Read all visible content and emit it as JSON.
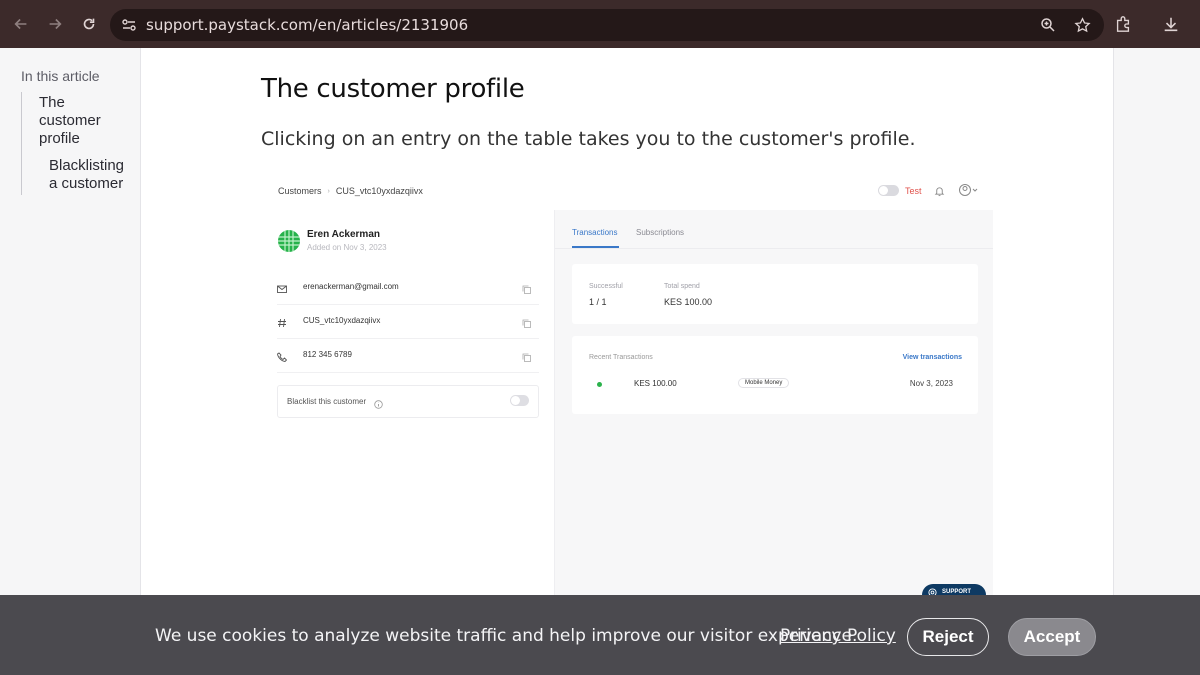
{
  "browser": {
    "url": "support.paystack.com/en/articles/2131906"
  },
  "toc": {
    "title": "In this article",
    "items": [
      {
        "label": "The customer profile"
      },
      {
        "label": "Blacklisting a customer"
      }
    ]
  },
  "article": {
    "heading": "The customer profile",
    "paragraph": "Clicking on an entry on the table takes you to the customer's profile."
  },
  "screenshot": {
    "breadcrumb": [
      "Customers",
      "CUS_vtc10yxdazqiivx"
    ],
    "test_label": "Test",
    "customer": {
      "name": "Eren Ackerman",
      "added": "Added on Nov 3, 2023",
      "email": "erenackerman@gmail.com",
      "code": "CUS_vtc10yxdazqiivx",
      "phone": "812 345 6789"
    },
    "blacklist_label": "Blacklist this customer",
    "tabs": [
      "Transactions",
      "Subscriptions"
    ],
    "stats": {
      "successful_label": "Successful",
      "successful_value": "1 / 1",
      "total_label": "Total spend",
      "total_value": "KES 100.00"
    },
    "recent": {
      "title": "Recent Transactions",
      "view_all": "View transactions",
      "row": {
        "amount": "KES 100.00",
        "channel": "Mobile Money",
        "date": "Nov 3, 2023"
      }
    },
    "support_label": "SUPPORT"
  },
  "cookie": {
    "text": "We use cookies to analyze website traffic and help improve our visitor experience.",
    "link": "Privacy Policy",
    "reject": "Reject",
    "accept": "Accept"
  },
  "colors": {
    "browser_bar": "#3c2a2a",
    "accent_blue": "#3a78c8",
    "success_green": "#2bb24c",
    "test_red": "#e0524c",
    "cookie_bg": "#4b4a4f"
  }
}
